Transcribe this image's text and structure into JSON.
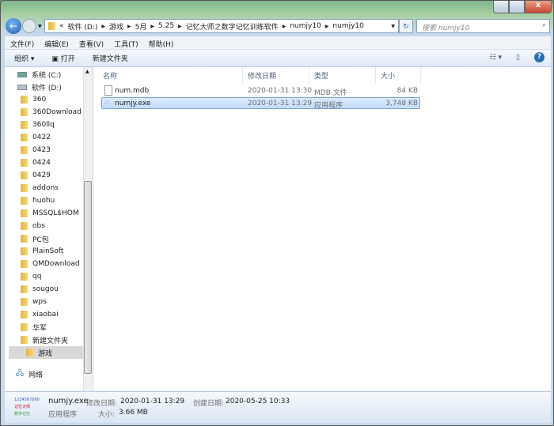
{
  "window": {
    "close": "x"
  },
  "address": {
    "crumbs": [
      "«",
      "软件 (D:)",
      "游戏",
      "5月",
      "5.25",
      "记忆大师之数字记忆训练软件",
      "numjy10",
      "numjy10"
    ],
    "search_placeholder": "搜索 numjy10"
  },
  "menu": [
    "文件(F)",
    "编辑(E)",
    "查看(V)",
    "工具(T)",
    "帮助(H)"
  ],
  "toolbar": {
    "organize": "组织 ▾",
    "open": "打开",
    "new_folder": "新建文件夹"
  },
  "tree": {
    "drives": [
      "系统 (C:)",
      "软件 (D:)"
    ],
    "folders": [
      "360",
      "360Download",
      "360llq",
      "0422",
      "0423",
      "0424",
      "0429",
      "addons",
      "huohu",
      "MSSQL$HOM",
      "obs",
      "PC包",
      "PlainSoft",
      "QMDownload",
      "qq",
      "sougou",
      "wps",
      "xiaobai",
      "华军",
      "新建文件夹",
      "游戏"
    ],
    "selected": "游戏",
    "network": "网络"
  },
  "list": {
    "headers": [
      "名称",
      "修改日期",
      "类型",
      "大小"
    ],
    "files": [
      {
        "name": "num.mdb",
        "date": "2020-01-31 13:30",
        "type": "MDB 文件",
        "size": "84 KB"
      },
      {
        "name": "numjy.exe",
        "date": "2020-01-31 13:29",
        "type": "应用程序",
        "size": "3,748 KB"
      }
    ]
  },
  "details": {
    "name": "numjy.exe",
    "type": "应用程序",
    "modified_label": "修改日期:",
    "modified": "2020-01-31 13:29",
    "created_label": "创建日期:",
    "created": "2020-05-25 10:33",
    "size_label": "大小:",
    "size": "3.66 MB"
  }
}
